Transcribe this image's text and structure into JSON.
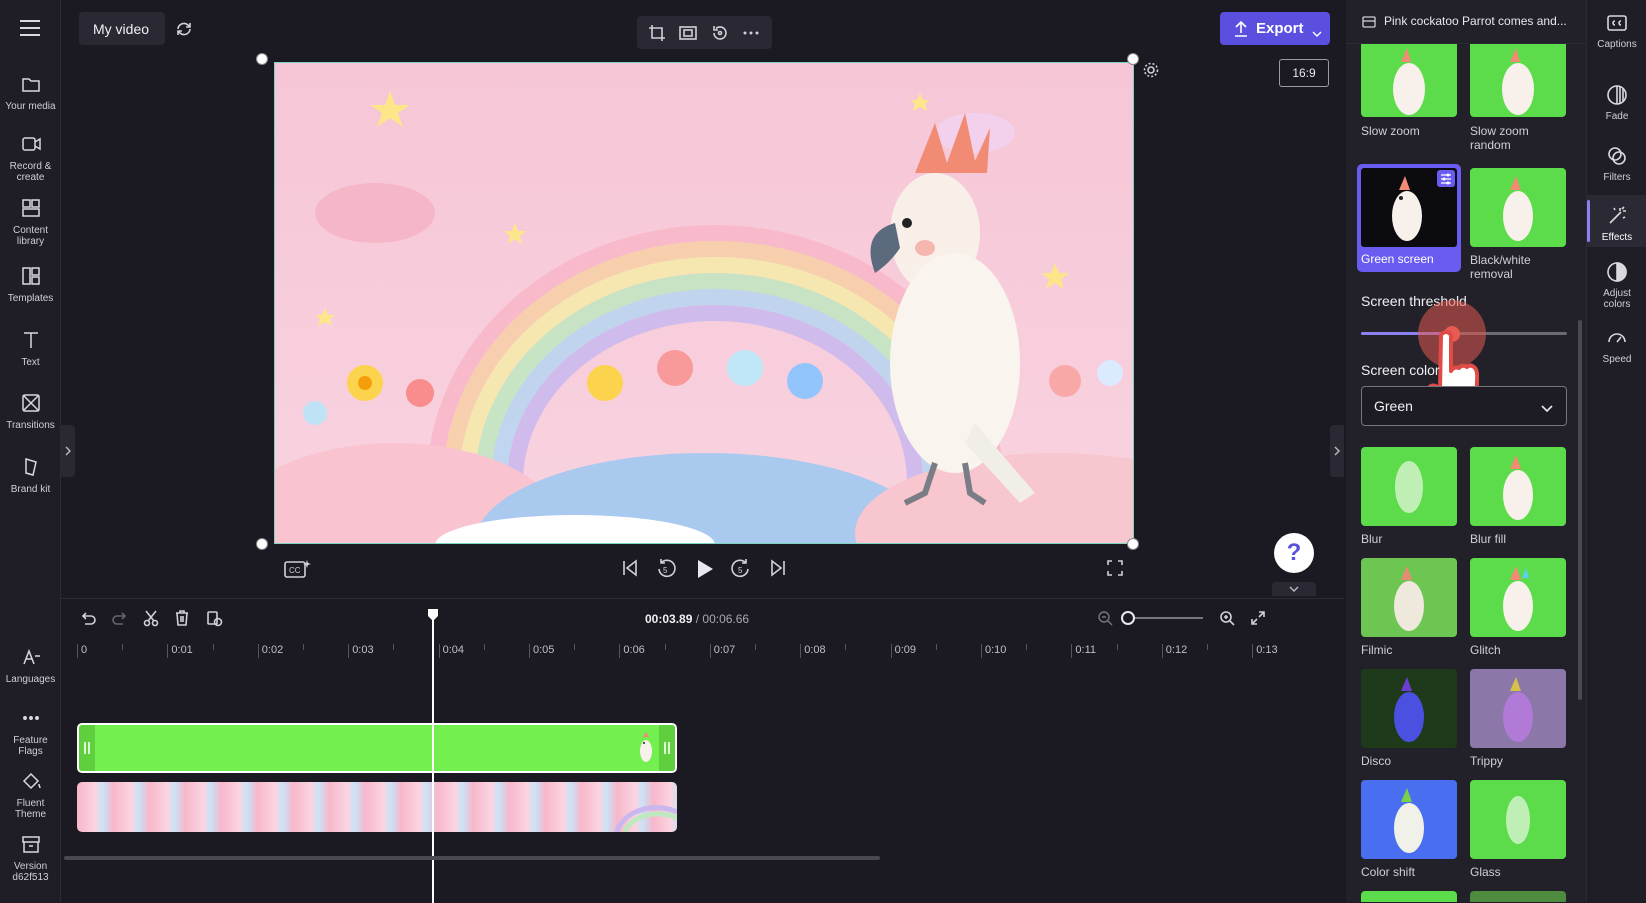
{
  "project": {
    "title": "My video"
  },
  "aspect_ratio": "16:9",
  "export": {
    "label": "Export"
  },
  "left_nav": [
    {
      "label": "Your media",
      "icon": "folder-icon"
    },
    {
      "label": "Record &\ncreate",
      "icon": "camera-icon"
    },
    {
      "label": "Content\nlibrary",
      "icon": "library-icon"
    },
    {
      "label": "Templates",
      "icon": "templates-icon"
    },
    {
      "label": "Text",
      "icon": "text-icon"
    },
    {
      "label": "Transitions",
      "icon": "transitions-icon"
    },
    {
      "label": "Brand kit",
      "icon": "brand-kit-icon"
    }
  ],
  "left_nav_bottom": [
    {
      "label": "Languages",
      "icon": "languages-icon"
    },
    {
      "label": "Feature\nFlags",
      "icon": "more-icon"
    },
    {
      "label": "Fluent\nTheme",
      "icon": "paint-bucket-icon"
    },
    {
      "label": "Version\nd62f513",
      "icon": "archive-icon"
    }
  ],
  "timeline": {
    "current_time": "00:03.89",
    "separator": " / ",
    "total_time": "00:06.66",
    "ticks": [
      "0",
      "0:01",
      "0:02",
      "0:03",
      "0:04",
      "0:05",
      "0:06",
      "0:07",
      "0:08",
      "0:09",
      "0:10",
      "0:11",
      "0:12",
      "0:13"
    ],
    "playhead_seconds": 3.89
  },
  "effects_panel": {
    "clip_title": "Pink cockatoo Parrot comes and...",
    "effects_top": [
      {
        "label": "Slow zoom"
      },
      {
        "label": "Slow zoom\nrandom"
      },
      {
        "label": "Green screen",
        "selected": true
      },
      {
        "label": "Black/white\nremoval"
      }
    ],
    "threshold_label": "Screen threshold",
    "threshold_value_fraction": 0.44,
    "color_label": "Screen color",
    "color_value": "Green",
    "effects_bottom": [
      {
        "label": "Blur"
      },
      {
        "label": "Blur fill"
      },
      {
        "label": "Filmic"
      },
      {
        "label": "Glitch"
      },
      {
        "label": "Disco"
      },
      {
        "label": "Trippy"
      },
      {
        "label": "Color shift"
      },
      {
        "label": "Glass"
      }
    ]
  },
  "right_rail": [
    {
      "label": "Captions",
      "icon": "captions-icon"
    },
    {
      "label": "Fade",
      "icon": "fade-icon"
    },
    {
      "label": "Filters",
      "icon": "filters-icon"
    },
    {
      "label": "Effects",
      "icon": "effects-icon",
      "active": true
    },
    {
      "label": "Adjust\ncolors",
      "icon": "adjust-colors-icon"
    },
    {
      "label": "Speed",
      "icon": "speed-icon"
    }
  ],
  "colors": {
    "accent": "#5b4fe0",
    "green": "#5ddc4b",
    "pink": "#f5c8d8"
  }
}
